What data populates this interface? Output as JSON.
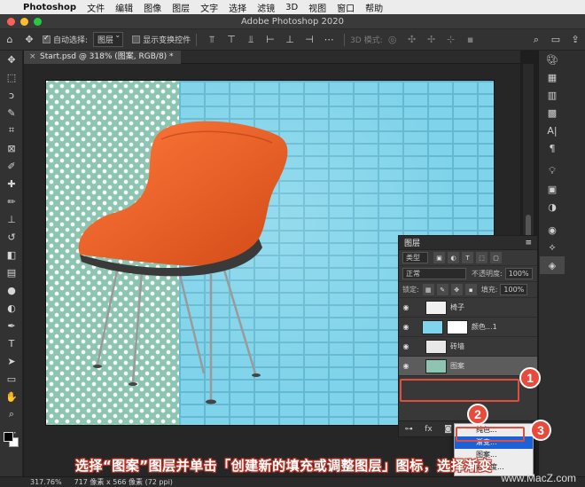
{
  "menubar": {
    "app_name": "Photoshop",
    "items": [
      "文件",
      "编辑",
      "图像",
      "图层",
      "文字",
      "选择",
      "滤镜",
      "3D",
      "视图",
      "窗口",
      "帮助"
    ]
  },
  "window": {
    "title": "Adobe Photoshop 2020"
  },
  "options_bar": {
    "auto_select_label": "自动选择:",
    "auto_select_target": "图层",
    "show_transform_label": "显示变换控件",
    "mode_3d_label": "3D 模式:"
  },
  "document": {
    "tab_title": "Start.psd @ 318% (图案, RGB/8) *"
  },
  "layers_panel": {
    "title": "图层",
    "filter_kind": "类型",
    "blend_mode": "正常",
    "opacity_label": "不透明度:",
    "opacity_value": "100%",
    "lock_label": "锁定:",
    "fill_label": "填充:",
    "fill_value": "100%",
    "layers": [
      {
        "name": "椅子",
        "selected": false
      },
      {
        "name": "颜色...1",
        "selected": false
      },
      {
        "name": "砖墙",
        "selected": false
      },
      {
        "name": "图案",
        "selected": true
      }
    ]
  },
  "popup_menu": {
    "items": [
      "纯色...",
      "渐变...",
      "图案...",
      "对比度..."
    ],
    "highlighted_index": 1
  },
  "callouts": {
    "one": "1",
    "two": "2",
    "three": "3"
  },
  "caption": "选择“图案”图层并单击「创建新的填充或调整图层」图标，选择渐变",
  "status_bar": {
    "zoom": "317.76%",
    "doc_size": "717 像素 x 566 像素 (72 ppi)"
  },
  "watermark": "www.MacZ.com"
}
